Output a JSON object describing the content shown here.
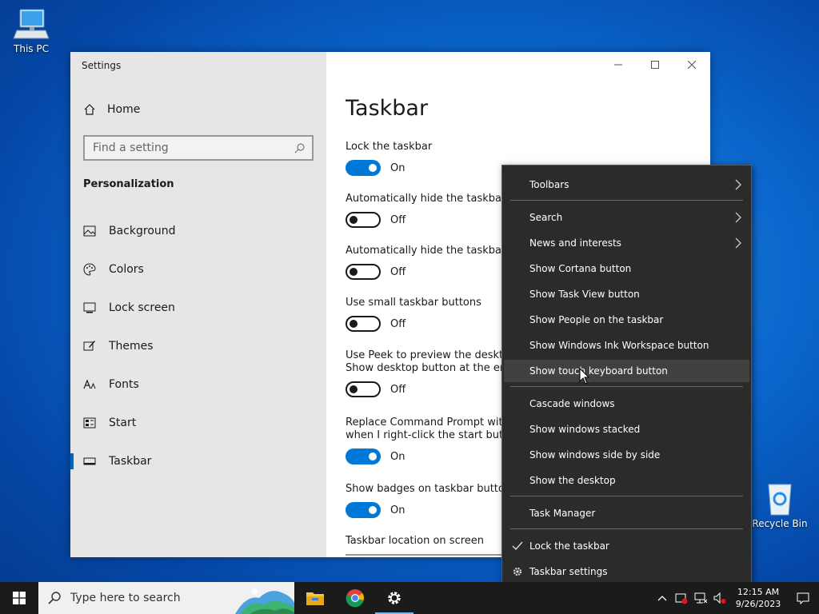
{
  "desktop": {
    "this_pc_label": "This PC",
    "recycle_bin_label": "Recycle Bin"
  },
  "settings": {
    "window_title": "Settings",
    "home_label": "Home",
    "search_placeholder": "Find a setting",
    "section_header": "Personalization",
    "nav_items": [
      {
        "label": "Background",
        "icon": "picture-icon"
      },
      {
        "label": "Colors",
        "icon": "palette-icon"
      },
      {
        "label": "Lock screen",
        "icon": "lock-screen-icon"
      },
      {
        "label": "Themes",
        "icon": "brush-icon"
      },
      {
        "label": "Fonts",
        "icon": "fonts-icon"
      },
      {
        "label": "Start",
        "icon": "start-icon"
      },
      {
        "label": "Taskbar",
        "icon": "taskbar-icon",
        "selected": true
      }
    ],
    "page_title": "Taskbar",
    "settings": [
      {
        "label": "Lock the taskbar",
        "state": "On"
      },
      {
        "label": "Automatically hide the taskbar i",
        "state": "Off"
      },
      {
        "label": "Automatically hide the taskbar i",
        "state": "Off"
      },
      {
        "label": "Use small taskbar buttons",
        "state": "Off"
      },
      {
        "label": "Use Peek to preview the desktop",
        "label2": "Show desktop button at the enc",
        "state": "Off"
      },
      {
        "label": "Replace Command Prompt with",
        "label2": "when I right-click the start butto",
        "state": "On"
      },
      {
        "label": "Show badges on taskbar button",
        "state": "On"
      }
    ],
    "location_label": "Taskbar location on screen"
  },
  "context_menu": {
    "items": {
      "toolbars": "Toolbars",
      "search": "Search",
      "news": "News and interests",
      "cortana": "Show Cortana button",
      "task_view": "Show Task View button",
      "people": "Show People on the taskbar",
      "ink": "Show Windows Ink Workspace button",
      "touch_keyboard": "Show touch keyboard button",
      "cascade": "Cascade windows",
      "stacked": "Show windows stacked",
      "side_by_side": "Show windows side by side",
      "show_desktop": "Show the desktop",
      "task_manager": "Task Manager",
      "lock_taskbar": "Lock the taskbar",
      "taskbar_settings": "Taskbar settings"
    }
  },
  "taskbar": {
    "search_placeholder": "Type here to search",
    "time": "12:15 AM",
    "date": "9/26/2023"
  },
  "colors": {
    "accent": "#0078d7",
    "menu_bg": "#2b2b2b",
    "taskbar_bg": "#1b1b1b"
  }
}
